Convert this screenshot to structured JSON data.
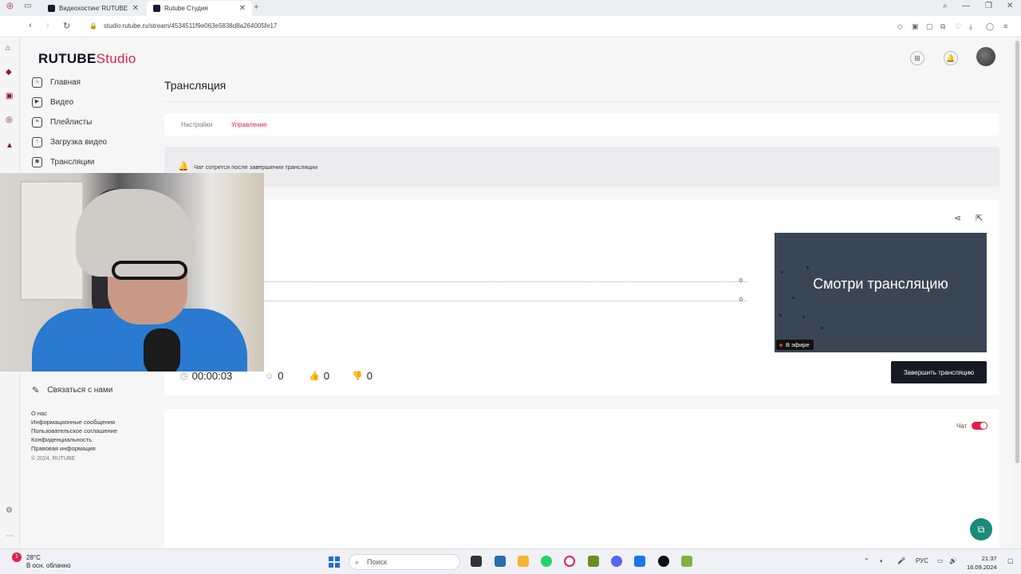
{
  "browser": {
    "tabs": [
      {
        "title": "Видеохостинг RUTUBE. Смотр..."
      },
      {
        "title": "Rutube Студия"
      }
    ],
    "url": "studio.rutube.ru/stream/4534511f9e063e5838d8a264005fe17"
  },
  "header": {
    "logo_main": "RUTUBE",
    "logo_studio": "Studio"
  },
  "sidebar": {
    "items": [
      {
        "label": "Главная"
      },
      {
        "label": "Видео"
      },
      {
        "label": "Плейлисты"
      },
      {
        "label": "Загрузка видео"
      },
      {
        "label": "Трансляции"
      }
    ],
    "contact": "Связаться с нами",
    "footer_links": [
      "О нас",
      "Информационные сообщения",
      "Пользовательское соглашение",
      "Конфиденциальность",
      "Правовая информация"
    ],
    "copyright": "© 2024, RUTUBE"
  },
  "page": {
    "title": "Трансляция",
    "tabs": [
      {
        "label": "Настройки"
      },
      {
        "label": "Управление"
      }
    ],
    "notice": "Чат сотрется после завершения трансляции"
  },
  "stream": {
    "chart_values": [
      "0",
      "0"
    ],
    "preview_text": "Смотри трансляцию",
    "live_badge": "В эфире",
    "duration": "00:00:03",
    "viewers": "0",
    "likes": "0",
    "dislikes": "0",
    "end_button": "Завершить трансляцию"
  },
  "chat": {
    "label": "Чат",
    "enabled": true
  },
  "taskbar": {
    "weather_temp": "28°C",
    "weather_desc": "В осн. облачно",
    "search_placeholder": "Поиск",
    "lang": "РУС",
    "time": "21:37",
    "date": "16.09.2024"
  },
  "colors": {
    "accent": "#e0234a",
    "dark_button": "#161a24",
    "preview_bg": "#3b4654"
  }
}
